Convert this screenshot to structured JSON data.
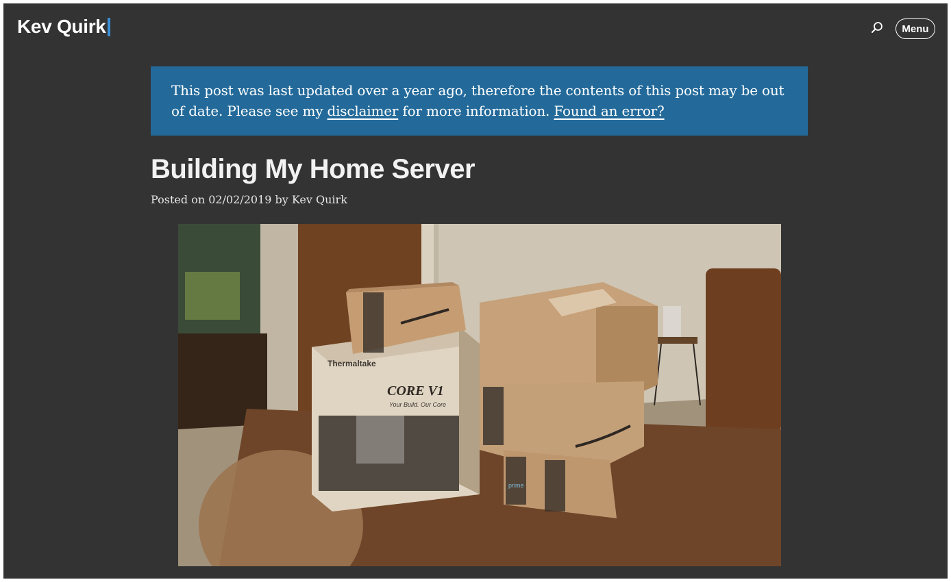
{
  "header": {
    "site_title": "Kev Quirk",
    "search_icon": "search-icon",
    "menu_label": "Menu"
  },
  "notice": {
    "text_before": "This post was last updated over a year ago, therefore the contents of this post may be out of date. Please see my ",
    "disclaimer_link": "disclaimer",
    "text_middle": " for more information. ",
    "error_link": "Found an error?"
  },
  "post": {
    "title": "Building My Home Server",
    "meta_prefix": "Posted on ",
    "date": "02/02/2019",
    "meta_by": " by ",
    "author": "Kev Quirk"
  },
  "image": {
    "box_brand": "Thermaltake",
    "box_model": "CORE V1",
    "box_tagline": "Your Build. Our Core",
    "prime_label": "prime"
  },
  "colors": {
    "background": "#333333",
    "notice": "#236a9a",
    "accent": "#3a8fd6"
  }
}
